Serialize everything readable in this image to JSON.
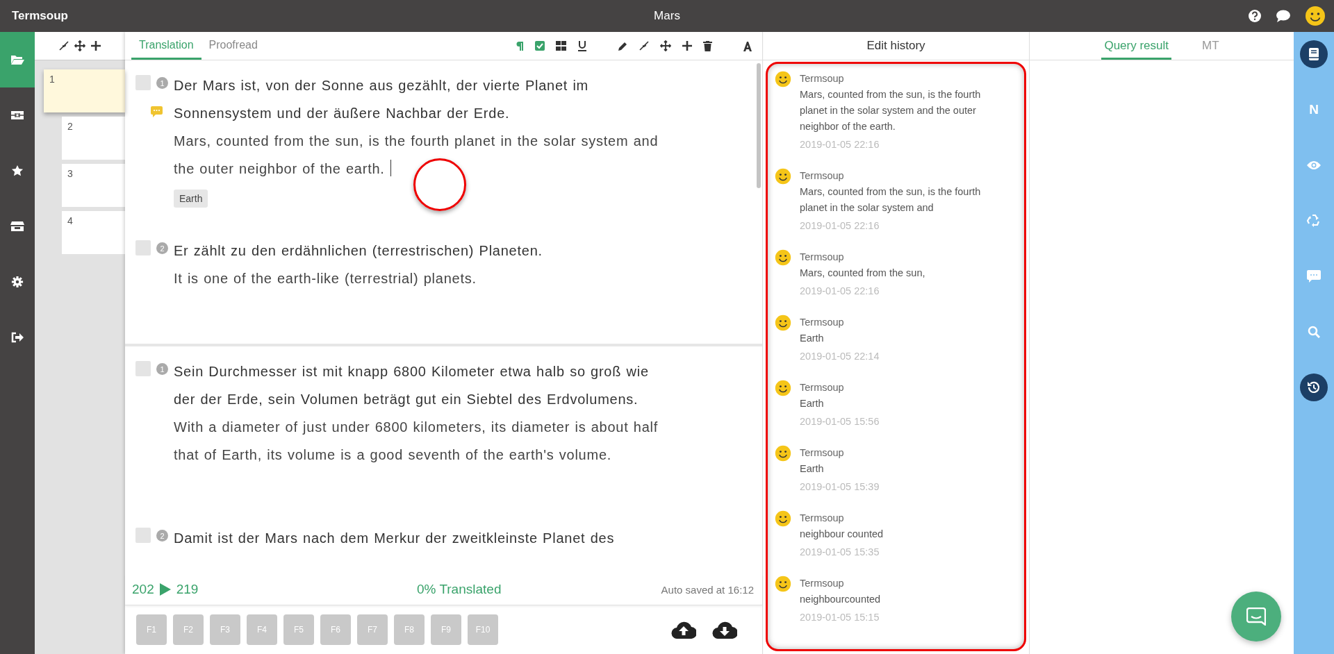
{
  "app": {
    "name": "Termsoup",
    "document_title": "Mars"
  },
  "nav": [
    {
      "kind": "folder",
      "selected": true
    },
    {
      "kind": "film",
      "selected": false
    },
    {
      "kind": "star",
      "selected": false
    },
    {
      "kind": "store",
      "selected": false
    },
    {
      "kind": "gear",
      "selected": false
    },
    {
      "kind": "logout",
      "selected": false
    }
  ],
  "segment_list": [
    {
      "number": "1",
      "selected": true
    },
    {
      "number": "2",
      "selected": false
    },
    {
      "number": "3",
      "selected": false
    },
    {
      "number": "4",
      "selected": false
    }
  ],
  "editor": {
    "tabs": [
      {
        "label": "Translation",
        "selected": true
      },
      {
        "label": "Proofread",
        "selected": false
      }
    ],
    "panes": [
      [
        {
          "number": "1",
          "checked": false,
          "source": "Der Mars ist, von der Sonne aus gezählt, der vierte Planet im Sonnensystem und der äußere Nachbar der Erde.",
          "comment": true,
          "target": "Mars, counted from the sun, is the fourth planet in the solar system and the outer neighbor of the earth.",
          "cursor": true,
          "circled": true,
          "terms": [
            "Earth"
          ]
        },
        {
          "number": "2",
          "checked": false,
          "source": "Er zählt zu den erdähnlichen (terrestrischen) Planeten.",
          "target": "It is one of the earth-like (terrestrial) planets."
        }
      ],
      [
        {
          "number": "1",
          "checked": false,
          "source": "Sein Durchmesser ist mit knapp 6800 Kilometer etwa halb so groß wie der der Erde, sein Volumen beträgt gut ein Siebtel des Erdvolumens.",
          "target": "With a diameter of just under 6800 kilometers, its diameter is about half that of Earth, its volume is a good seventh of the earth's volume."
        },
        {
          "number": "2",
          "checked": false,
          "source": "Damit ist der Mars nach dem Merkur der zweitkleinste Planet des"
        }
      ]
    ]
  },
  "status": {
    "source_count": "202",
    "target_count": "219",
    "progress": "0% Translated",
    "autosave": "Auto saved at 16:12"
  },
  "function_keys": [
    "F1",
    "F2",
    "F3",
    "F4",
    "F5",
    "F6",
    "F7",
    "F8",
    "F9",
    "F10"
  ],
  "history": {
    "title": "Edit history",
    "outlined": true,
    "entries": [
      {
        "author": "Termsoup",
        "text": "Mars, counted from the sun, is the fourth planet in the solar system and the outer neighbor of the earth.",
        "time": "2019-01-05 22:16"
      },
      {
        "author": "Termsoup",
        "text": "Mars, counted from the sun, is the fourth planet in the solar system and",
        "time": "2019-01-05 22:16"
      },
      {
        "author": "Termsoup",
        "text": "Mars, counted from the sun,",
        "time": "2019-01-05 22:16"
      },
      {
        "author": "Termsoup",
        "text": "Earth",
        "time": "2019-01-05 22:14"
      },
      {
        "author": "Termsoup",
        "text": "Earth",
        "time": "2019-01-05 15:56"
      },
      {
        "author": "Termsoup",
        "text": "Earth",
        "time": "2019-01-05 15:39"
      },
      {
        "author": "Termsoup",
        "text": "neighbour counted",
        "time": "2019-01-05 15:35"
      },
      {
        "author": "Termsoup",
        "text": "neighbourcounted",
        "time": "2019-01-05 15:15"
      }
    ]
  },
  "results": {
    "tabs": [
      {
        "label": "Query result",
        "selected": true
      },
      {
        "label": "MT",
        "selected": false
      }
    ]
  },
  "right_bar": [
    {
      "kind": "book",
      "selected": true
    },
    {
      "kind": "letter",
      "label": "N",
      "selected": false
    },
    {
      "kind": "eye",
      "selected": false
    },
    {
      "kind": "recycle",
      "selected": false
    },
    {
      "kind": "chat",
      "selected": false
    },
    {
      "kind": "search",
      "selected": false
    },
    {
      "kind": "history",
      "selected": true
    }
  ]
}
